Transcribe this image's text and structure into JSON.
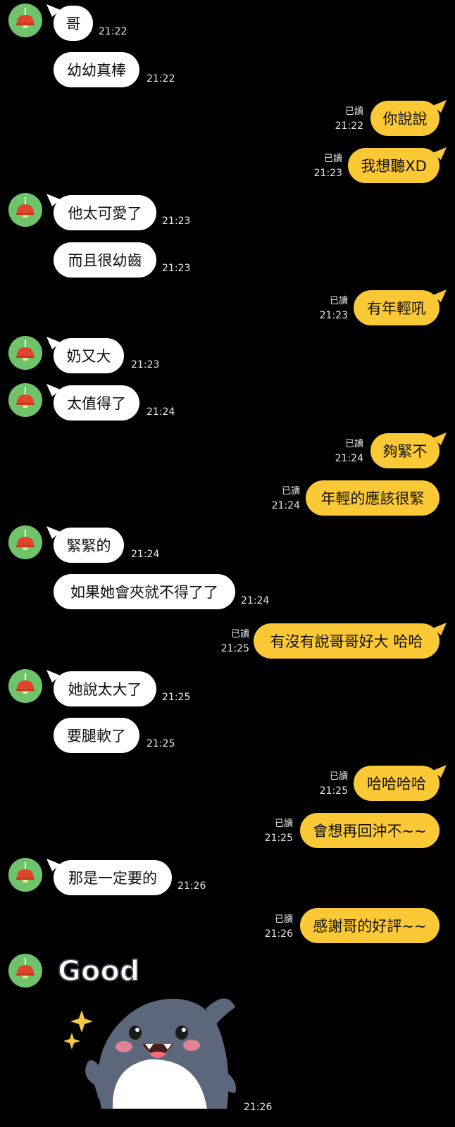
{
  "conversation": {
    "messages": [
      {
        "side": "in",
        "text": "哥",
        "time": "21:22",
        "avatar": true
      },
      {
        "side": "in",
        "text": "幼幼真棒",
        "time": "21:22"
      },
      {
        "side": "out",
        "text": "你說說",
        "time": "21:22",
        "read": "已讀"
      },
      {
        "side": "out",
        "text": "我想聽XD",
        "time": "21:23",
        "read": "已讀"
      },
      {
        "side": "in",
        "text": "他太可愛了",
        "time": "21:23",
        "avatar": true
      },
      {
        "side": "in",
        "text": "而且很幼齒",
        "time": "21:23"
      },
      {
        "side": "out",
        "text": "有年輕吼",
        "time": "21:23",
        "read": "已讀"
      },
      {
        "side": "in",
        "text": "奶又大",
        "time": "21:23",
        "avatar": true
      },
      {
        "side": "in",
        "text": "太值得了",
        "time": "21:24",
        "avatar": true
      },
      {
        "side": "out",
        "text": "夠緊不",
        "time": "21:24",
        "read": "已讀"
      },
      {
        "side": "out",
        "text": "年輕的應該很緊",
        "time": "21:24",
        "read": "已讀"
      },
      {
        "side": "in",
        "text": "緊緊的",
        "time": "21:24",
        "avatar": true
      },
      {
        "side": "in",
        "text": "如果她會夾就不得了了",
        "time": "21:24"
      },
      {
        "side": "out",
        "text": "有沒有說哥哥好大 哈哈",
        "time": "21:25",
        "read": "已讀"
      },
      {
        "side": "in",
        "text": "她說太大了",
        "time": "21:25",
        "avatar": true
      },
      {
        "side": "in",
        "text": "要腿軟了",
        "time": "21:25"
      },
      {
        "side": "out",
        "text": "哈哈哈哈",
        "time": "21:25",
        "read": "已讀"
      },
      {
        "side": "out",
        "text": "會想再回沖不~~",
        "time": "21:25",
        "read": "已讀"
      },
      {
        "side": "in",
        "text": "那是一定要的",
        "time": "21:26",
        "avatar": true
      },
      {
        "side": "out",
        "text": "感謝哥的好評~~",
        "time": "21:26",
        "read": "已讀"
      }
    ],
    "sticker": {
      "label": "Good",
      "time": "21:26",
      "icon": "shark-good-sticker"
    }
  },
  "colors": {
    "background": "#000000",
    "incoming_bubble": "#ffffff",
    "outgoing_bubble": "#fbc935",
    "avatar_bg": "#6fc36b",
    "avatar_lamp": "#e0452c"
  }
}
